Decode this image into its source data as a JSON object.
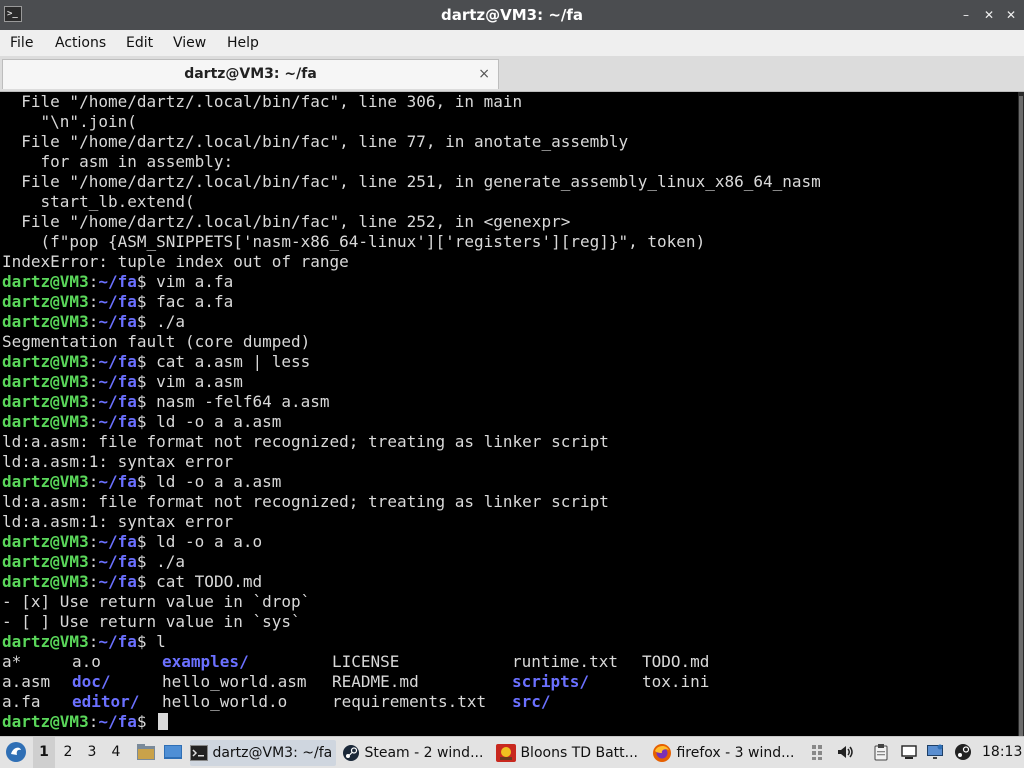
{
  "window": {
    "title": "dartz@VM3: ~/fa",
    "controls": [
      "–",
      "✕",
      "✕"
    ]
  },
  "menu": [
    "File",
    "Actions",
    "Edit",
    "View",
    "Help"
  ],
  "tab": {
    "title": "dartz@VM3: ~/fa",
    "close": "×"
  },
  "prompt": {
    "user": "dartz@VM3",
    "sep": ":",
    "path": "~/fa",
    "sym": "$ "
  },
  "terminal": {
    "lines": [
      {
        "t": "o",
        "text": "  File \"/home/dartz/.local/bin/fac\", line 306, in main"
      },
      {
        "t": "o",
        "text": "    \"\\n\".join("
      },
      {
        "t": "o",
        "text": "  File \"/home/dartz/.local/bin/fac\", line 77, in anotate_assembly"
      },
      {
        "t": "o",
        "text": "    for asm in assembly:"
      },
      {
        "t": "o",
        "text": "  File \"/home/dartz/.local/bin/fac\", line 251, in generate_assembly_linux_x86_64_nasm"
      },
      {
        "t": "o",
        "text": "    start_lb.extend("
      },
      {
        "t": "o",
        "text": "  File \"/home/dartz/.local/bin/fac\", line 252, in <genexpr>"
      },
      {
        "t": "o",
        "text": "    (f\"pop {ASM_SNIPPETS['nasm-x86_64-linux']['registers'][reg]}\", token)"
      },
      {
        "t": "o",
        "text": "IndexError: tuple index out of range"
      },
      {
        "t": "p",
        "text": "vim a.fa"
      },
      {
        "t": "p",
        "text": "fac a.fa"
      },
      {
        "t": "p",
        "text": "./a"
      },
      {
        "t": "o",
        "text": "Segmentation fault (core dumped)"
      },
      {
        "t": "p",
        "text": "cat a.asm | less"
      },
      {
        "t": "p",
        "text": "vim a.asm"
      },
      {
        "t": "p",
        "text": "nasm -felf64 a.asm"
      },
      {
        "t": "p",
        "text": "ld -o a a.asm"
      },
      {
        "t": "o",
        "text": "ld:a.asm: file format not recognized; treating as linker script"
      },
      {
        "t": "o",
        "text": "ld:a.asm:1: syntax error"
      },
      {
        "t": "p",
        "text": "ld -o a a.asm"
      },
      {
        "t": "o",
        "text": "ld:a.asm: file format not recognized; treating as linker script"
      },
      {
        "t": "o",
        "text": "ld:a.asm:1: syntax error"
      },
      {
        "t": "p",
        "text": "ld -o a a.o"
      },
      {
        "t": "p",
        "text": "./a"
      },
      {
        "t": "p",
        "text": "cat TODO.md"
      },
      {
        "t": "o",
        "text": "- [x] Use return value in `drop`"
      },
      {
        "t": "o",
        "text": "- [ ] Use return value in `sys`"
      },
      {
        "t": "p",
        "text": "l"
      },
      {
        "t": "ls",
        "cells": [
          {
            "text": "a*",
            "w": 7,
            "k": "exec"
          },
          {
            "text": "a.o",
            "w": 9,
            "k": "file"
          },
          {
            "text": "examples/",
            "w": 17,
            "k": "dir"
          },
          {
            "text": "LICENSE",
            "w": 18,
            "k": "file"
          },
          {
            "text": "runtime.txt",
            "w": 13,
            "k": "file"
          },
          {
            "text": "TODO.md",
            "w": 0,
            "k": "file"
          }
        ]
      },
      {
        "t": "ls",
        "cells": [
          {
            "text": "a.asm",
            "w": 7,
            "k": "file"
          },
          {
            "text": "doc/",
            "w": 9,
            "k": "dir"
          },
          {
            "text": "hello_world.asm",
            "w": 17,
            "k": "file"
          },
          {
            "text": "README.md",
            "w": 18,
            "k": "file"
          },
          {
            "text": "scripts/",
            "w": 13,
            "k": "dir"
          },
          {
            "text": "tox.ini",
            "w": 0,
            "k": "file"
          }
        ]
      },
      {
        "t": "ls",
        "cells": [
          {
            "text": "a.fa",
            "w": 7,
            "k": "file"
          },
          {
            "text": "editor/",
            "w": 9,
            "k": "dir"
          },
          {
            "text": "hello_world.o",
            "w": 17,
            "k": "file"
          },
          {
            "text": "requirements.txt",
            "w": 18,
            "k": "file"
          },
          {
            "text": "src/",
            "w": 13,
            "k": "dir"
          }
        ]
      },
      {
        "t": "p",
        "text": "",
        "cursor": true
      }
    ]
  },
  "taskbar": {
    "workspaces": [
      "1",
      "2",
      "3",
      "4"
    ],
    "active_workspace": "1",
    "tasks": [
      {
        "label": "dartz@VM3: ~/fa",
        "icon": "terminal-icon",
        "active": true
      },
      {
        "label": "Steam - 2 wind...",
        "icon": "steam-icon",
        "active": false
      },
      {
        "label": "Bloons TD Batt...",
        "icon": "bloons-icon",
        "active": false
      },
      {
        "label": "firefox - 3 wind...",
        "icon": "firefox-icon",
        "active": false
      }
    ],
    "clock": "18:13"
  },
  "colors": {
    "prompt_user": "#5ad75a",
    "prompt_path": "#6b70ff",
    "directory": "#6b70ff",
    "terminal_text": "#d9d9d9",
    "terminal_bg": "#000000",
    "titlebar": "#4b4d50"
  }
}
